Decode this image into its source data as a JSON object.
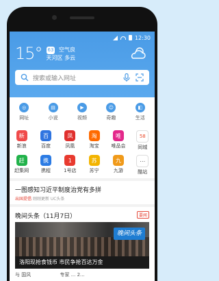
{
  "status": {
    "time": "12:30"
  },
  "weather": {
    "temp": "15°",
    "aqi_value": "63",
    "aqi_text": "空气良",
    "location": "天河区",
    "condition": "多云"
  },
  "search": {
    "placeholder": "搜索或输入网址"
  },
  "nav": {
    "items": [
      {
        "label": "网址"
      },
      {
        "label": "小说"
      },
      {
        "label": "视频"
      },
      {
        "label": "奇趣"
      },
      {
        "label": "生活"
      }
    ]
  },
  "apps": {
    "row1": [
      {
        "label": "新浪",
        "color": "#f04a4a",
        "glyph": "新"
      },
      {
        "label": "百度",
        "color": "#2f74e0",
        "glyph": "百"
      },
      {
        "label": "凤凰",
        "color": "#e0302e",
        "glyph": "凤"
      },
      {
        "label": "淘宝",
        "color": "#ff6a00",
        "glyph": "淘"
      },
      {
        "label": "唯品会",
        "color": "#e3278a",
        "glyph": "唯"
      },
      {
        "label": "同城",
        "color": "#ffffff",
        "glyph": "58"
      }
    ],
    "row2": [
      {
        "label": "赶集网",
        "color": "#21b24a",
        "glyph": "赶"
      },
      {
        "label": "携程",
        "color": "#2b7be4",
        "glyph": "携"
      },
      {
        "label": "1号店",
        "color": "#e83a2f",
        "glyph": "1"
      },
      {
        "label": "苏宁",
        "color": "#f3b400",
        "glyph": "苏"
      },
      {
        "label": "九游",
        "color": "#f09a1a",
        "glyph": "九"
      },
      {
        "label": "酷站",
        "color": "#ffffff",
        "glyph": "⋯"
      }
    ]
  },
  "headline": {
    "title": "一图感知习近平制度治党有多拼",
    "tag": "出国提倡",
    "meta": "刚刚更新   UC头条"
  },
  "evening": {
    "title": "晚间头条（11月7日）",
    "badge": "要闻",
    "photo_badge": "晚间头条",
    "caption": "洛阳现抢食钱币 市民争抢百达万金",
    "more_left": "与 国风",
    "more_right": "专家 ... 2..."
  },
  "colors": {
    "accent": "#4a9be6",
    "hot": "#e54a3c"
  }
}
